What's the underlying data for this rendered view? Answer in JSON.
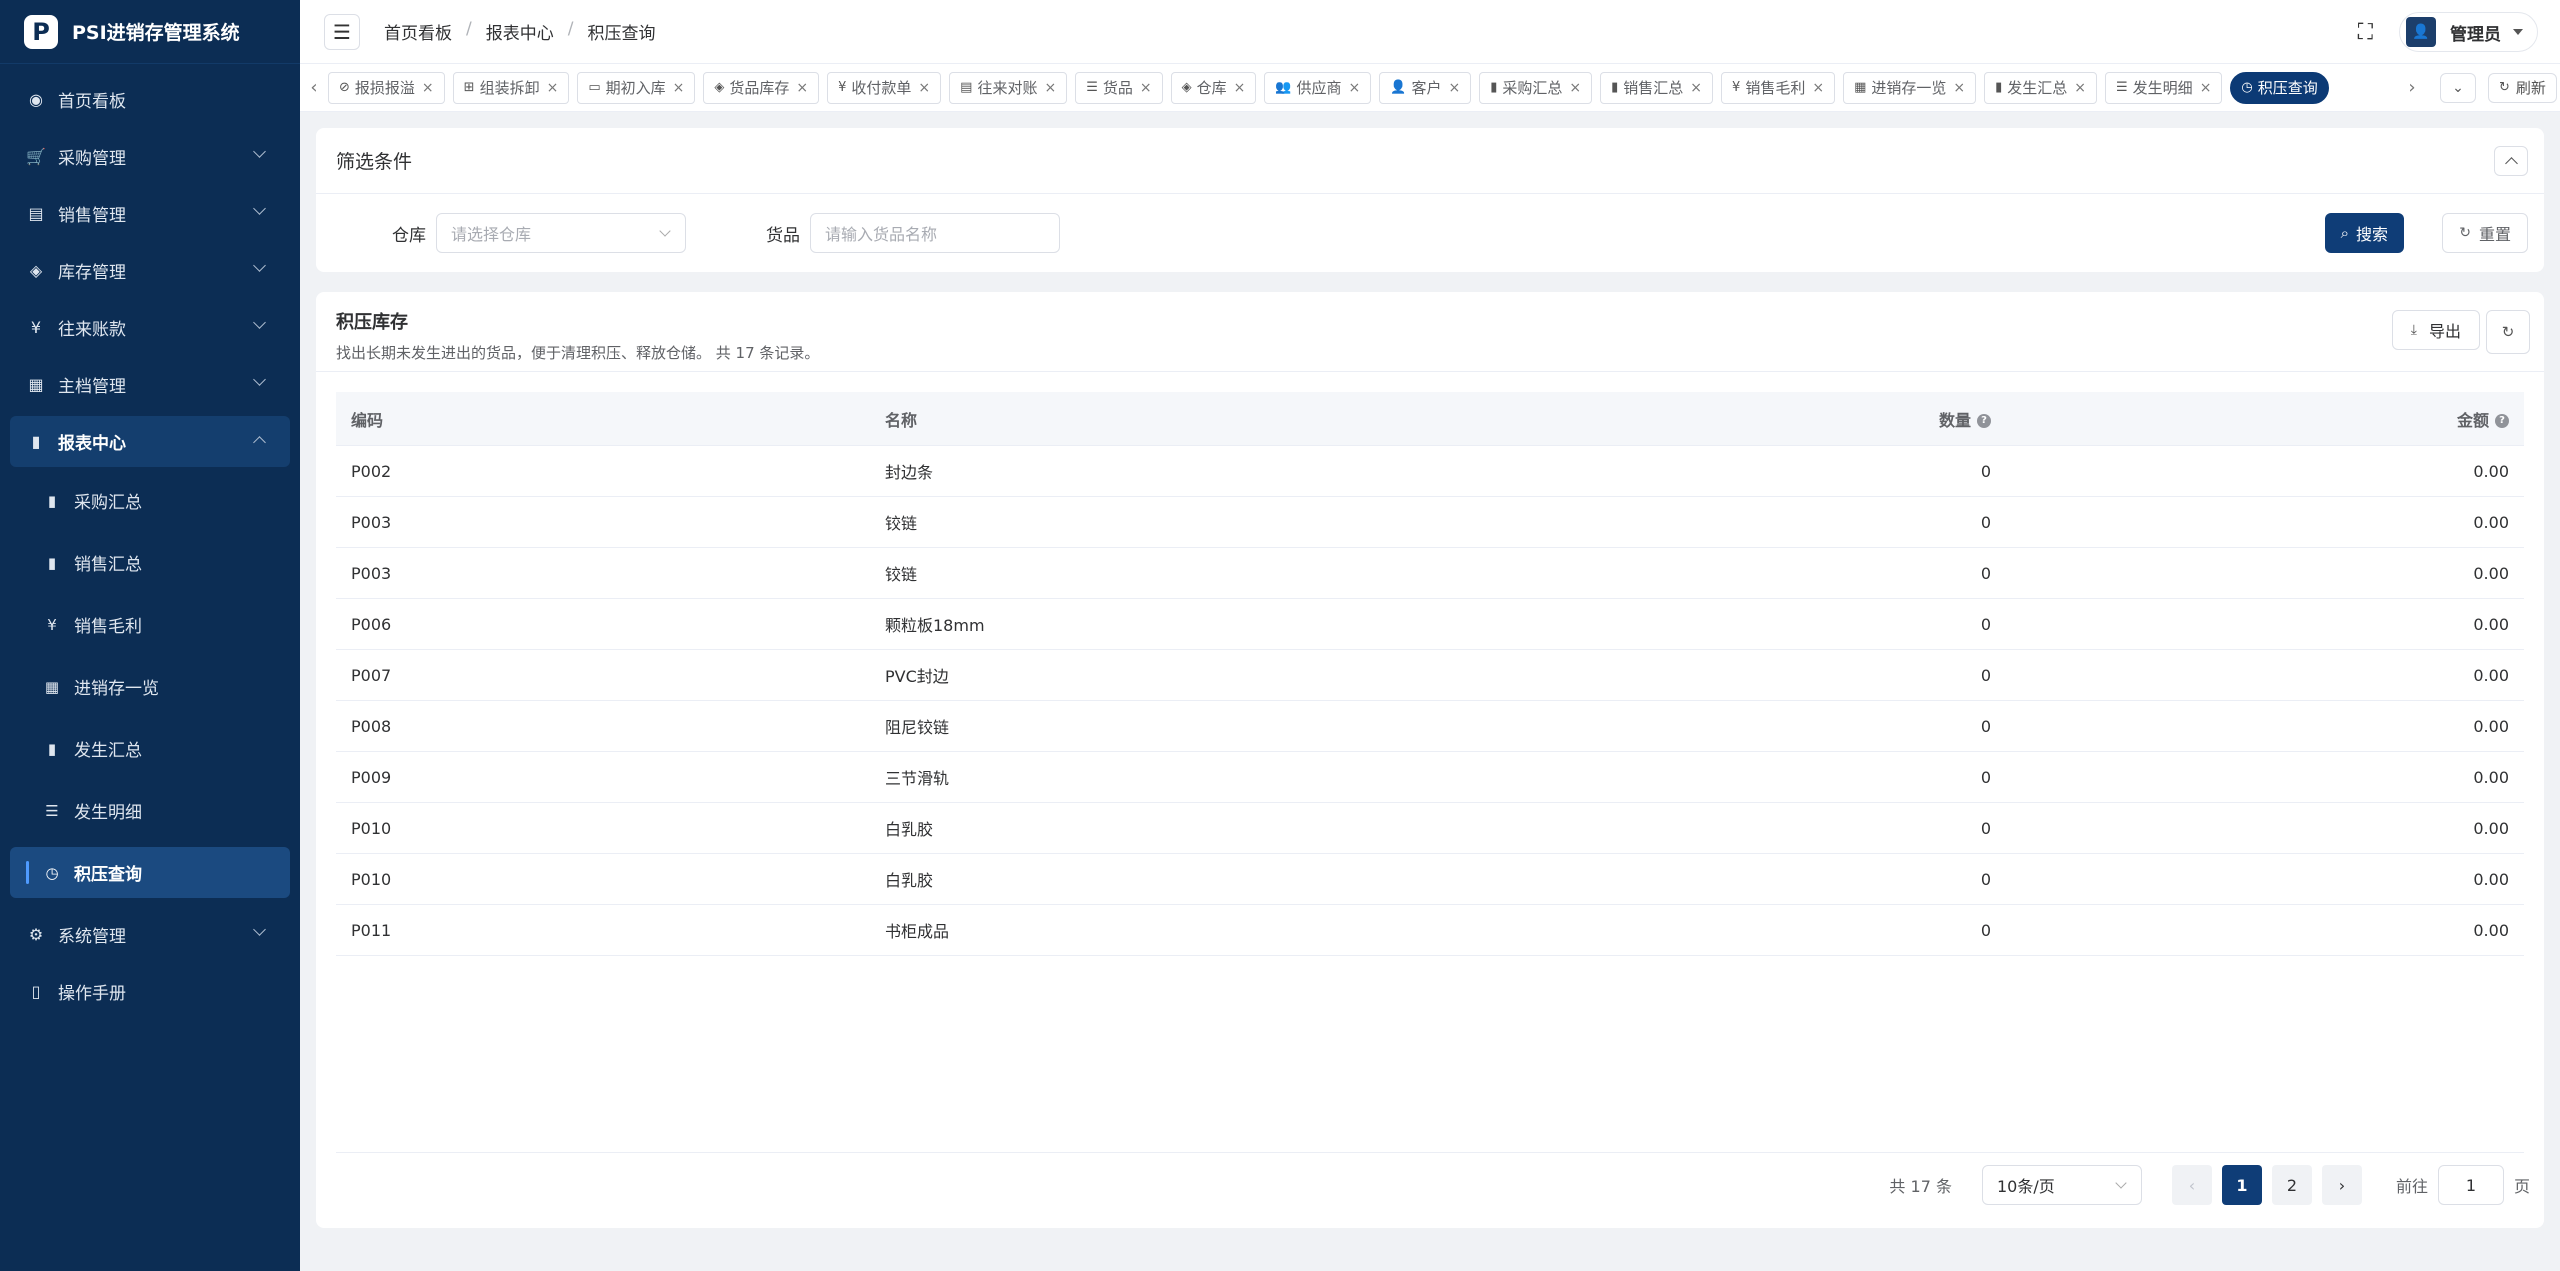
{
  "app": {
    "logo_letter": "P",
    "title": "PSI进销存管理系统"
  },
  "sidebar": {
    "items": [
      {
        "label": "首页看板",
        "icon": "dashboard-icon",
        "glyph": "◉",
        "expandable": false
      },
      {
        "label": "采购管理",
        "icon": "cart-icon",
        "glyph": "🛒",
        "expandable": true
      },
      {
        "label": "销售管理",
        "icon": "sales-icon",
        "glyph": "▤",
        "expandable": true
      },
      {
        "label": "库存管理",
        "icon": "stack-icon",
        "glyph": "◈",
        "expandable": true
      },
      {
        "label": "往来账款",
        "icon": "yen-icon",
        "glyph": "¥",
        "expandable": true
      },
      {
        "label": "主档管理",
        "icon": "database-icon",
        "glyph": "▦",
        "expandable": true
      },
      {
        "label": "报表中心",
        "icon": "bar-chart-icon",
        "glyph": "▮",
        "expandable": true,
        "open": true
      }
    ],
    "sub_items": [
      {
        "label": "采购汇总",
        "icon": "bar-chart-icon",
        "glyph": "▮"
      },
      {
        "label": "销售汇总",
        "icon": "bar-chart-icon",
        "glyph": "▮"
      },
      {
        "label": "销售毛利",
        "icon": "yen-icon",
        "glyph": "¥"
      },
      {
        "label": "进销存一览",
        "icon": "table-icon",
        "glyph": "▦"
      },
      {
        "label": "发生汇总",
        "icon": "bar-chart-icon",
        "glyph": "▮"
      },
      {
        "label": "发生明细",
        "icon": "list-icon",
        "glyph": "☰"
      },
      {
        "label": "积压查询",
        "icon": "clock-icon",
        "glyph": "◷",
        "active": true
      }
    ],
    "bottom_items": [
      {
        "label": "系统管理",
        "icon": "gear-icon",
        "glyph": "⚙",
        "expandable": true
      },
      {
        "label": "操作手册",
        "icon": "book-icon",
        "glyph": "▯",
        "expandable": false
      }
    ]
  },
  "header": {
    "breadcrumb": [
      "首页看板",
      "报表中心",
      "积压查询"
    ],
    "user": "管理员"
  },
  "tabs": [
    {
      "label": "报损报溢",
      "glyph": "⊘"
    },
    {
      "label": "组装拆卸",
      "glyph": "⊞"
    },
    {
      "label": "期初入库",
      "glyph": "▭"
    },
    {
      "label": "货品库存",
      "glyph": "◈"
    },
    {
      "label": "收付款单",
      "glyph": "¥"
    },
    {
      "label": "往来对账",
      "glyph": "▤"
    },
    {
      "label": "货品",
      "glyph": "☰"
    },
    {
      "label": "仓库",
      "glyph": "◈"
    },
    {
      "label": "供应商",
      "glyph": "👥"
    },
    {
      "label": "客户",
      "glyph": "👤"
    },
    {
      "label": "采购汇总",
      "glyph": "▮"
    },
    {
      "label": "销售汇总",
      "glyph": "▮"
    },
    {
      "label": "销售毛利",
      "glyph": "¥"
    },
    {
      "label": "进销存一览",
      "glyph": "▦"
    },
    {
      "label": "发生汇总",
      "glyph": "▮"
    },
    {
      "label": "发生明细",
      "glyph": "☰"
    },
    {
      "label": "积压查询",
      "glyph": "◷",
      "active": true
    }
  ],
  "tabs_refresh": "刷新",
  "filter": {
    "title": "筛选条件",
    "warehouse_label": "仓库",
    "warehouse_placeholder": "请选择仓库",
    "goods_label": "货品",
    "goods_placeholder": "请输入货品名称",
    "search": "搜索",
    "reset": "重置"
  },
  "table": {
    "title": "积压库存",
    "description": "找出长期未发生进出的货品，便于清理积压、释放仓储。 共 17 条记录。",
    "export": "导出",
    "columns": {
      "code": "编码",
      "name": "名称",
      "qty": "数量",
      "amount": "金额"
    },
    "rows": [
      {
        "code": "P002",
        "name": "封边条",
        "qty": "0",
        "amount": "0.00"
      },
      {
        "code": "P003",
        "name": "铰链",
        "qty": "0",
        "amount": "0.00"
      },
      {
        "code": "P003",
        "name": "铰链",
        "qty": "0",
        "amount": "0.00"
      },
      {
        "code": "P006",
        "name": "颗粒板18mm",
        "qty": "0",
        "amount": "0.00"
      },
      {
        "code": "P007",
        "name": "PVC封边",
        "qty": "0",
        "amount": "0.00"
      },
      {
        "code": "P008",
        "name": "阻尼铰链",
        "qty": "0",
        "amount": "0.00"
      },
      {
        "code": "P009",
        "name": "三节滑轨",
        "qty": "0",
        "amount": "0.00"
      },
      {
        "code": "P010",
        "name": "白乳胶",
        "qty": "0",
        "amount": "0.00"
      },
      {
        "code": "P010",
        "name": "白乳胶",
        "qty": "0",
        "amount": "0.00"
      },
      {
        "code": "P011",
        "name": "书柜成品",
        "qty": "0",
        "amount": "0.00"
      }
    ]
  },
  "pagination": {
    "total": "共 17 条",
    "page_size": "10条/页",
    "pages": [
      "1",
      "2"
    ],
    "current": "1",
    "goto_label": "前往",
    "goto_value": "1",
    "page_suffix": "页"
  },
  "colors": {
    "sidebar_bg": "#0c2d54",
    "primary": "#0f3d77",
    "active_tab": "#0c3a75"
  }
}
